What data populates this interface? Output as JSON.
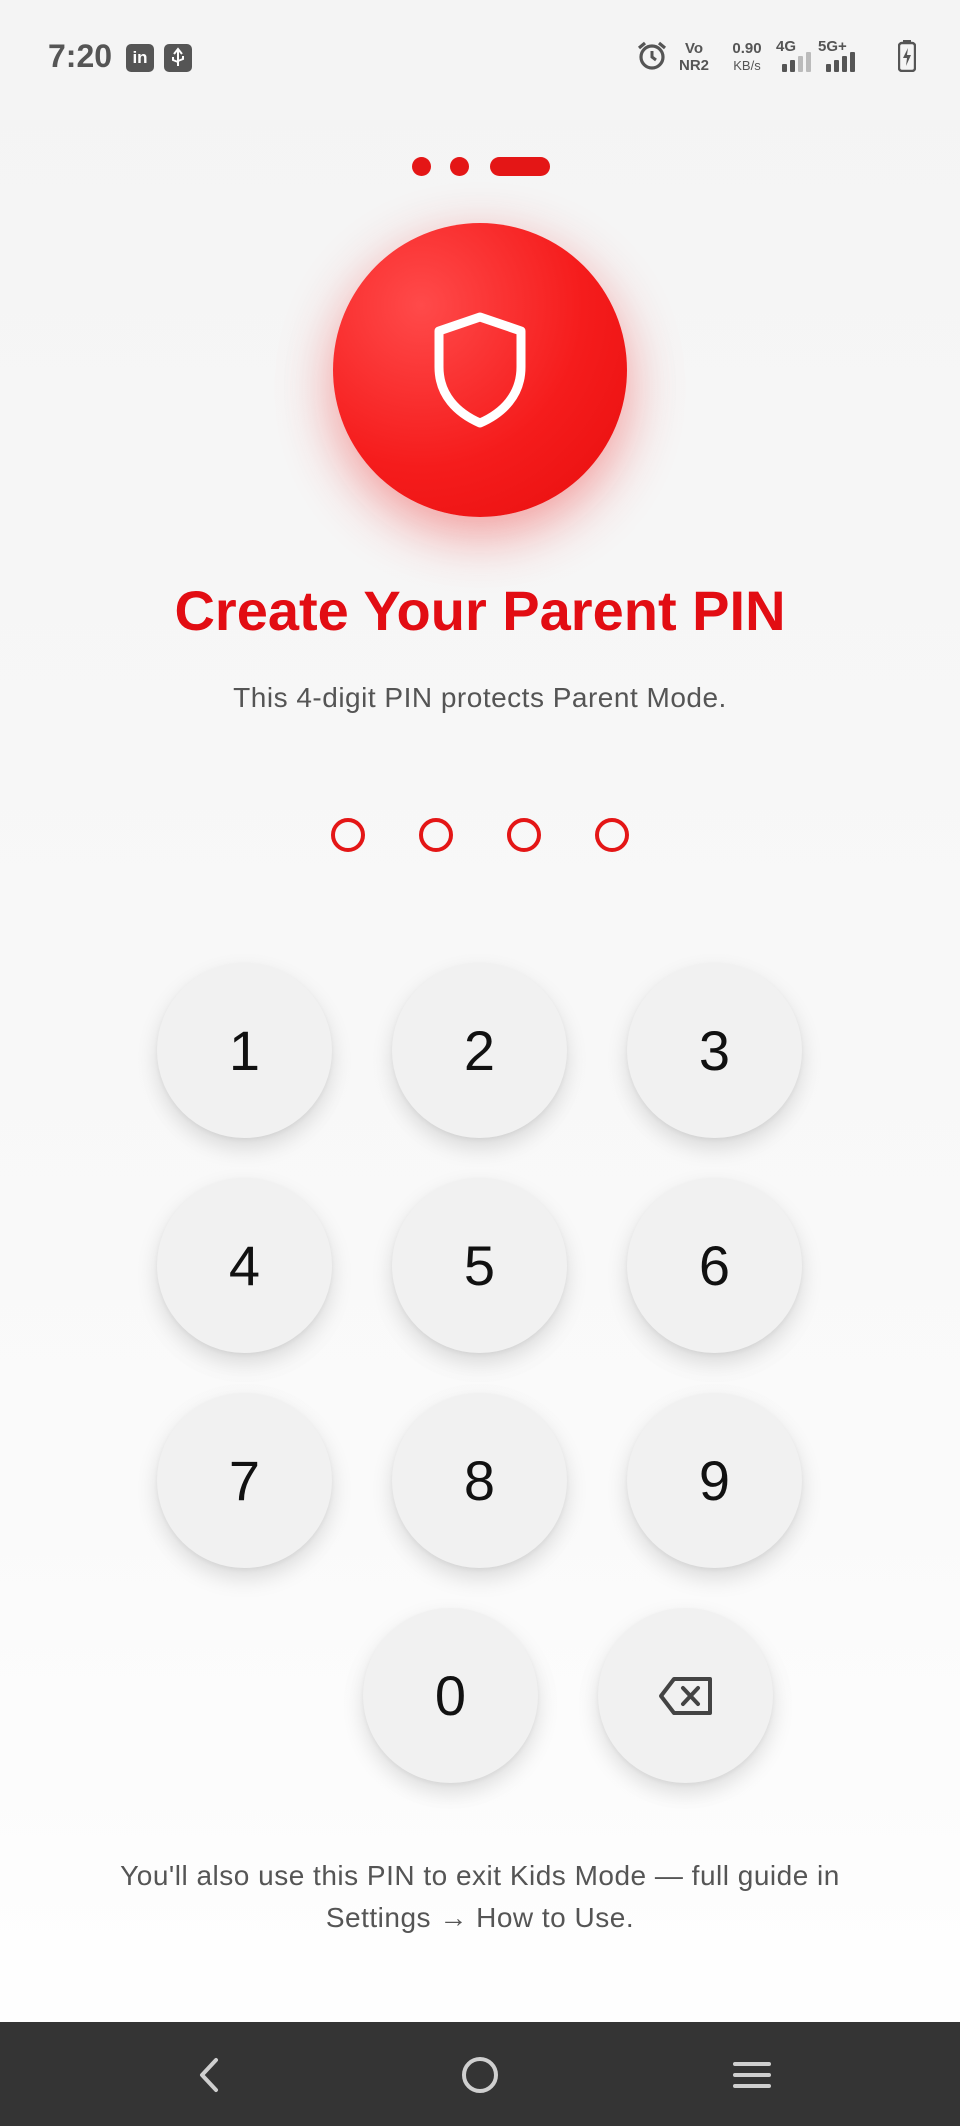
{
  "status_bar": {
    "time": "7:20",
    "linkedin_icon": "linkedin-icon",
    "usb_icon": "usb-icon",
    "alarm_icon": "alarm-icon",
    "volte_top": "Vo",
    "volte_bottom": "NR2",
    "speed_value": "0.90",
    "speed_unit": "KB/s",
    "network_1": "4G",
    "network_2": "5G+",
    "battery_icon": "battery-charging-icon"
  },
  "progress": {
    "steps": 3,
    "current": 3
  },
  "hero_icon": "shield-icon",
  "title": "Create Your Parent PIN",
  "subtitle": "This 4-digit PIN protects Parent Mode.",
  "pin": {
    "length": 4,
    "entered": 0
  },
  "keypad": {
    "keys": [
      "1",
      "2",
      "3",
      "4",
      "5",
      "6",
      "7",
      "8",
      "9",
      "0"
    ],
    "backspace_icon": "backspace-icon"
  },
  "footer_note_line1": "You'll also use this PIN to exit Kids Mode — full guide in",
  "footer_note_line2": "Settings → How to Use.",
  "nav": {
    "back_icon": "back-icon",
    "home_icon": "home-icon",
    "menu_icon": "recents-menu-icon"
  },
  "colors": {
    "accent": "#e41616",
    "title": "#e20d13",
    "key_background": "#f1f1f1",
    "nav_background": "#343434"
  }
}
